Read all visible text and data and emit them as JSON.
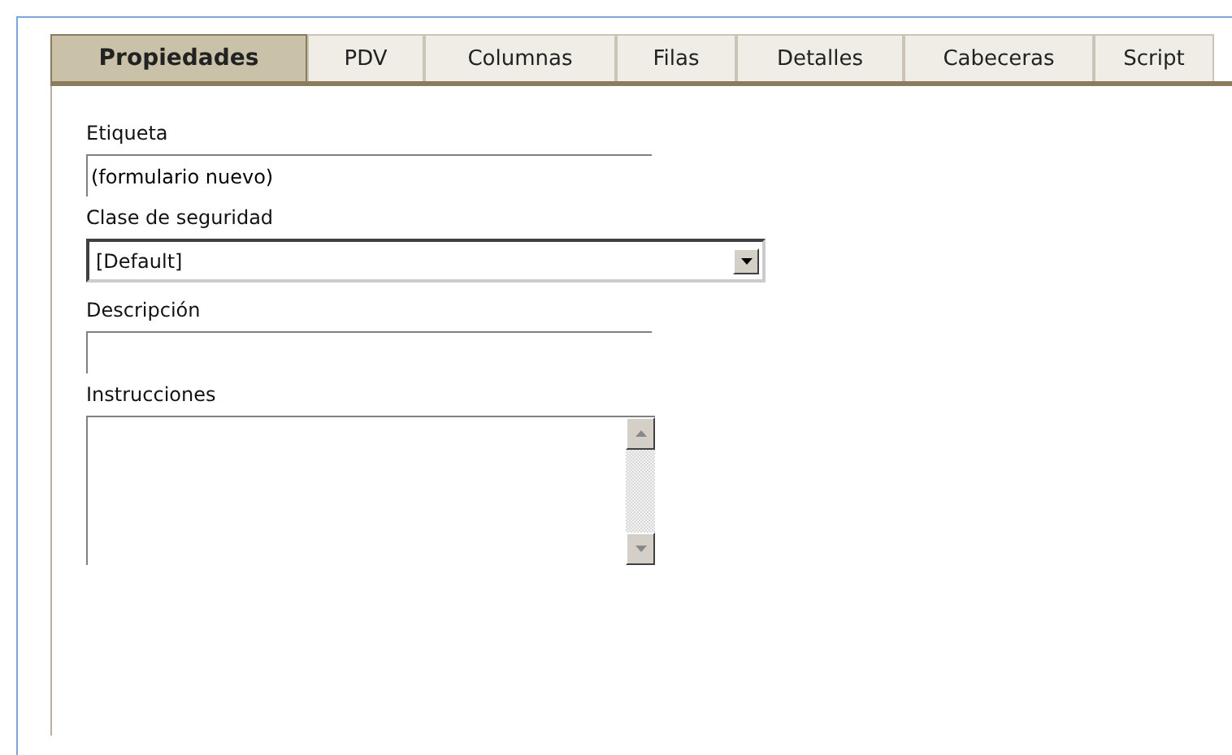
{
  "tabs": [
    {
      "label": "Propiedades",
      "selected": true
    },
    {
      "label": "PDV",
      "selected": false
    },
    {
      "label": "Columnas",
      "selected": false
    },
    {
      "label": "Filas",
      "selected": false
    },
    {
      "label": "Detalles",
      "selected": false
    },
    {
      "label": "Cabeceras",
      "selected": false
    },
    {
      "label": "Script",
      "selected": false
    }
  ],
  "fields": [
    {
      "kind": "text",
      "label": "Etiqueta",
      "value": "(formulario nuevo)"
    },
    {
      "kind": "select",
      "label": "Clase de seguridad",
      "value": "[Default]"
    },
    {
      "kind": "text",
      "label": "Descripción"
    },
    {
      "kind": "textarea",
      "label": "Instrucciones"
    }
  ]
}
